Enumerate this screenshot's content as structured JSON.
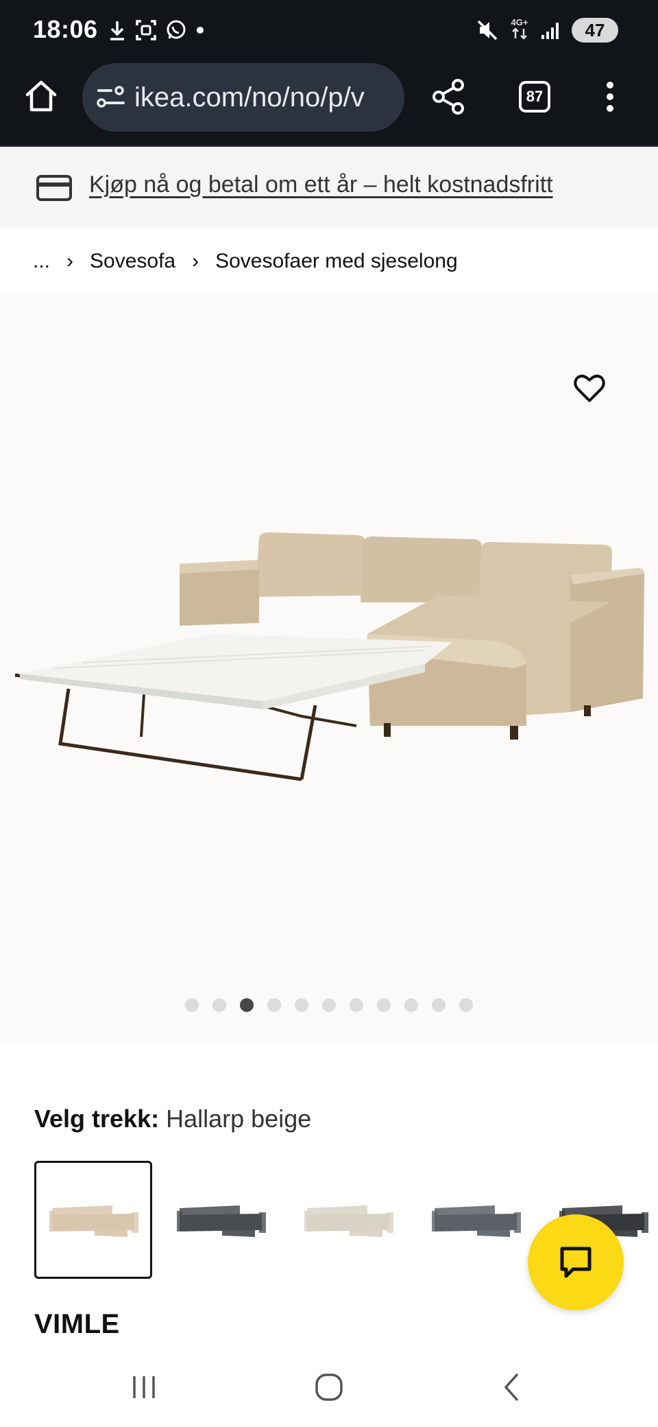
{
  "status_bar": {
    "time": "18:06",
    "network": "4G+",
    "battery": "47",
    "icons_left": [
      "download-icon",
      "screenshot-icon",
      "whatsapp-icon",
      "dot-icon"
    ],
    "icons_right": [
      "mute-icon",
      "network-icon",
      "signal-icon",
      "battery-icon"
    ]
  },
  "browser": {
    "url": "ikea.com/no/no/p/v",
    "tab_count": "87"
  },
  "promo": {
    "text": "Kjøp nå og betal om ett år – helt kostnadsfritt"
  },
  "breadcrumb": {
    "items": [
      "...",
      "Sovesofa",
      "Sovesofaer med sjeselong"
    ]
  },
  "gallery": {
    "image_count": 11,
    "active_index": 2
  },
  "product": {
    "choose_label": "Velg trekk:",
    "choose_value": "Hallarp beige",
    "name": "VIMLE",
    "swatch_colors": [
      "#d8c7ad",
      "#4a4d50",
      "#d9d3c5",
      "#5c6169",
      "#35373b"
    ]
  },
  "colors": {
    "chrome_bg": "#111418",
    "url_bg": "#2c3340",
    "fab_yellow": "#fbd914"
  }
}
